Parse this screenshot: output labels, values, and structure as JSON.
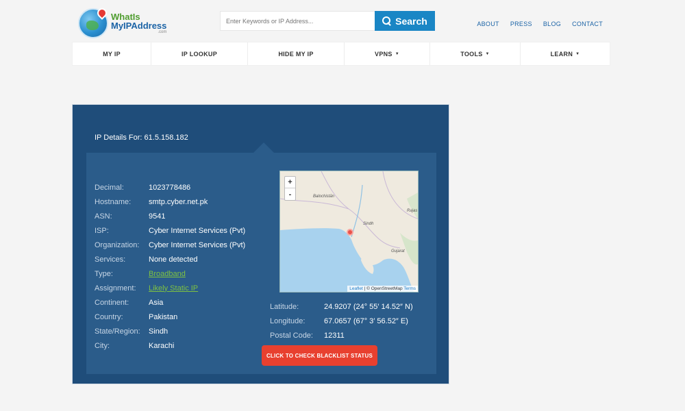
{
  "logo": {
    "line1": "WhatIs",
    "line2": "MyIPAddress",
    "line3": ".com"
  },
  "search": {
    "placeholder": "Enter Keywords or IP Address...",
    "button_label": "Search"
  },
  "top_links": [
    "ABOUT",
    "PRESS",
    "BLOG",
    "CONTACT"
  ],
  "nav": [
    {
      "label": "MY IP",
      "caret": ""
    },
    {
      "label": "IP LOOKUP",
      "caret": ""
    },
    {
      "label": "HIDE MY IP",
      "caret": ""
    },
    {
      "label": "VPNS",
      "caret": "▼"
    },
    {
      "label": "TOOLS",
      "caret": "▼"
    },
    {
      "label": "LEARN",
      "caret": "▼"
    }
  ],
  "panel": {
    "title": "IP Details For: 61.5.158.182",
    "details": [
      {
        "label": "Decimal:",
        "value": "1023778486"
      },
      {
        "label": "Hostname:",
        "value": "smtp.cyber.net.pk"
      },
      {
        "label": "ASN:",
        "value": "9541"
      },
      {
        "label": "ISP:",
        "value": "Cyber Internet Services (Pvt)"
      },
      {
        "label": "Organization:",
        "value": "Cyber Internet Services (Pvt)"
      },
      {
        "label": "Services:",
        "value": "None detected"
      },
      {
        "label": "Type:",
        "value": "Broadband"
      },
      {
        "label": "Assignment:",
        "value": "Likely Static IP"
      },
      {
        "label": "Continent:",
        "value": "Asia"
      },
      {
        "label": "Country:",
        "value": "Pakistan"
      },
      {
        "label": "State/Region:",
        "value": "Sindh"
      },
      {
        "label": "City:",
        "value": "Karachi"
      }
    ],
    "geo": [
      {
        "label": "Latitude:",
        "value": "24.9207  (24° 55′ 14.52″ N)"
      },
      {
        "label": "Longitude:",
        "value": "67.0657  (67° 3′ 56.52″ E)"
      },
      {
        "label": "Postal Code:",
        "value": "12311"
      }
    ],
    "blacklist_button": "CLICK TO CHECK BLACKLIST STATUS"
  },
  "map": {
    "zoom_in": "+",
    "zoom_out": "-",
    "labels": {
      "balochistan": "Balochistān",
      "sindh": "Sindh",
      "rajasthan": "Rajas",
      "gujarat": "Gujarat"
    },
    "attribution": {
      "leaflet": "Leaflet",
      "separator": " | © OpenStreetMap ",
      "terms": "Terms"
    },
    "colors": {
      "water": "#a8d2ee",
      "land": "#efeadf",
      "marker": "#e9524a"
    }
  },
  "colors": {
    "panel_bg": "#1f4d7a",
    "inner_bg": "#2b5c8a",
    "link_green": "#7ec242",
    "button_red": "#e8402f",
    "search_blue": "#1a86c5"
  }
}
